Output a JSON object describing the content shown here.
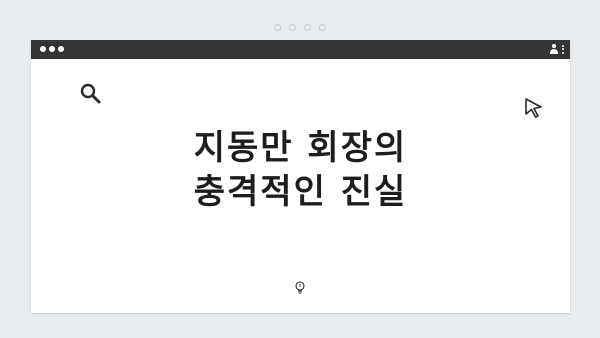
{
  "window": {
    "title_line_1": "지동만 회장의",
    "title_line_2": "충격적인 진실"
  },
  "icons": {
    "search": "search-icon",
    "cursor": "cursor-icon",
    "bulb": "lightbulb-icon",
    "user": "user-icon",
    "menu": "kebab-menu-icon"
  },
  "colors": {
    "titlebar": "#343434",
    "background": "#e9edf1",
    "text": "#1d1d1d"
  }
}
